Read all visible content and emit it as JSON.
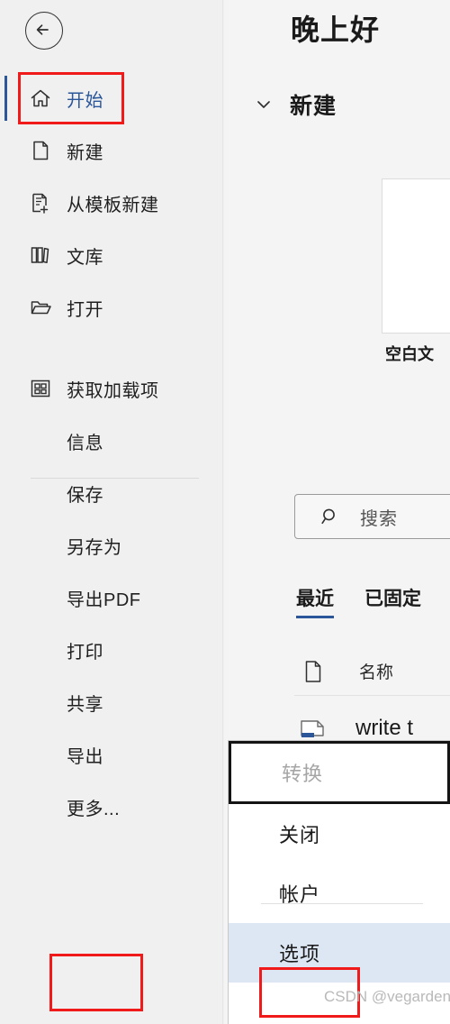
{
  "window": {
    "back_button_icon": "arrow-left-circle-icon",
    "background_color": "#f0f0f0"
  },
  "sidebar": {
    "accent_color": "#2b579a",
    "items": [
      {
        "label": "开始",
        "icon": "home-icon",
        "selected": true,
        "highlighted": true
      },
      {
        "label": "新建",
        "icon": "new-document-icon",
        "selected": false,
        "highlighted": false
      },
      {
        "label": "从模板新建",
        "icon": "template-new-icon",
        "selected": false,
        "highlighted": false
      },
      {
        "label": "文库",
        "icon": "library-icon",
        "selected": false,
        "highlighted": false
      },
      {
        "label": "打开",
        "icon": "folder-open-icon",
        "selected": false,
        "highlighted": false
      },
      {
        "label": "获取加载项",
        "icon": "addins-grid-icon",
        "selected": false,
        "highlighted": false
      },
      {
        "label": "信息",
        "icon": "",
        "selected": false,
        "highlighted": false
      },
      {
        "label": "保存",
        "icon": "",
        "selected": false,
        "highlighted": false
      },
      {
        "label": "另存为",
        "icon": "",
        "selected": false,
        "highlighted": false
      },
      {
        "label": "导出PDF",
        "icon": "",
        "selected": false,
        "highlighted": false
      },
      {
        "label": "打印",
        "icon": "",
        "selected": false,
        "highlighted": false
      },
      {
        "label": "共享",
        "icon": "",
        "selected": false,
        "highlighted": false
      },
      {
        "label": "导出",
        "icon": "",
        "selected": false,
        "highlighted": false
      },
      {
        "label": "更多...",
        "icon": "",
        "selected": false,
        "highlighted": true
      }
    ]
  },
  "main": {
    "greeting": "晚上好",
    "new_section": {
      "title": "新建",
      "chevron_icon": "chevron-down-icon",
      "template_label": "空白文"
    },
    "search": {
      "icon": "search-icon",
      "placeholder": "搜索"
    },
    "tabs": [
      {
        "label": "最近",
        "active": true
      },
      {
        "label": "已固定",
        "active": false
      }
    ],
    "recent_table": {
      "header_icon": "document-icon",
      "header_name": "名称",
      "rows": [
        {
          "icon": "word-document-icon",
          "name": "write t"
        }
      ]
    }
  },
  "context_menu": {
    "highlight_color": "#dde6f3",
    "items": [
      {
        "label": "转换",
        "disabled": true,
        "focused": true,
        "highlighted": false
      },
      {
        "label": "关闭",
        "disabled": false,
        "focused": false,
        "highlighted": false
      },
      {
        "label": "帐户",
        "disabled": false,
        "focused": false,
        "highlighted": false
      },
      {
        "label": "选项",
        "disabled": false,
        "focused": false,
        "highlighted": true
      }
    ]
  },
  "annotations": {
    "box_color": "#f01a1a",
    "boxes": [
      "开始",
      "更多...",
      "选项"
    ]
  },
  "watermark": "CSDN @vegardener"
}
